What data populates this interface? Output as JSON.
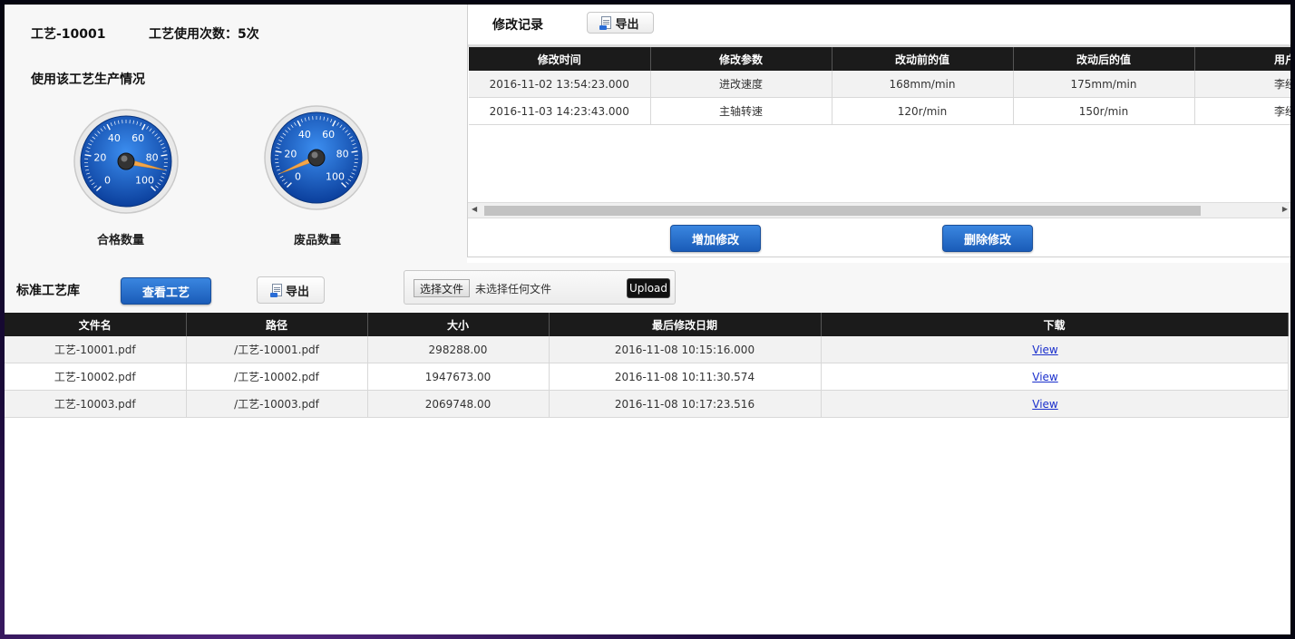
{
  "process": {
    "id_label": "工艺-10001",
    "usage_label": "工艺使用次数：5次",
    "production_title": "使用该工艺生产情况"
  },
  "gauges": [
    {
      "name": "合格数量",
      "value": 88,
      "ticks": [
        "0",
        "20",
        "40",
        "60",
        "80",
        "100"
      ]
    },
    {
      "name": "废品数量",
      "value": 8,
      "ticks": [
        "0",
        "20",
        "40",
        "60",
        "80",
        "100"
      ]
    }
  ],
  "modlog": {
    "title": "修改记录",
    "export_label": "导出",
    "columns": [
      "修改时间",
      "修改参数",
      "改动前的值",
      "改动后的值",
      "用户"
    ],
    "rows": [
      [
        "2016-11-02 13:54:23.000",
        "进改速度",
        "168mm/min",
        "175mm/min",
        "李经"
      ],
      [
        "2016-11-03 14:23:43.000",
        "主轴转速",
        "120r/min",
        "150r/min",
        "李经"
      ]
    ],
    "add_label": "增加修改",
    "delete_label": "删除修改"
  },
  "library": {
    "title": "标准工艺库",
    "view_label": "查看工艺",
    "export_label": "导出",
    "choose_file_label": "选择文件",
    "no_file_label": "未选择任何文件",
    "upload_label": "Upload",
    "columns": [
      "文件名",
      "路径",
      "大小",
      "最后修改日期",
      "下载"
    ],
    "rows": [
      [
        "工艺-10001.pdf",
        "/工艺-10001.pdf",
        "298288.00",
        "2016-11-08 10:15:16.000",
        "View"
      ],
      [
        "工艺-10002.pdf",
        "/工艺-10002.pdf",
        "1947673.00",
        "2016-11-08 10:11:30.574",
        "View"
      ],
      [
        "工艺-10003.pdf",
        "/工艺-10003.pdf",
        "2069748.00",
        "2016-11-08 10:17:23.516",
        "View"
      ]
    ]
  }
}
